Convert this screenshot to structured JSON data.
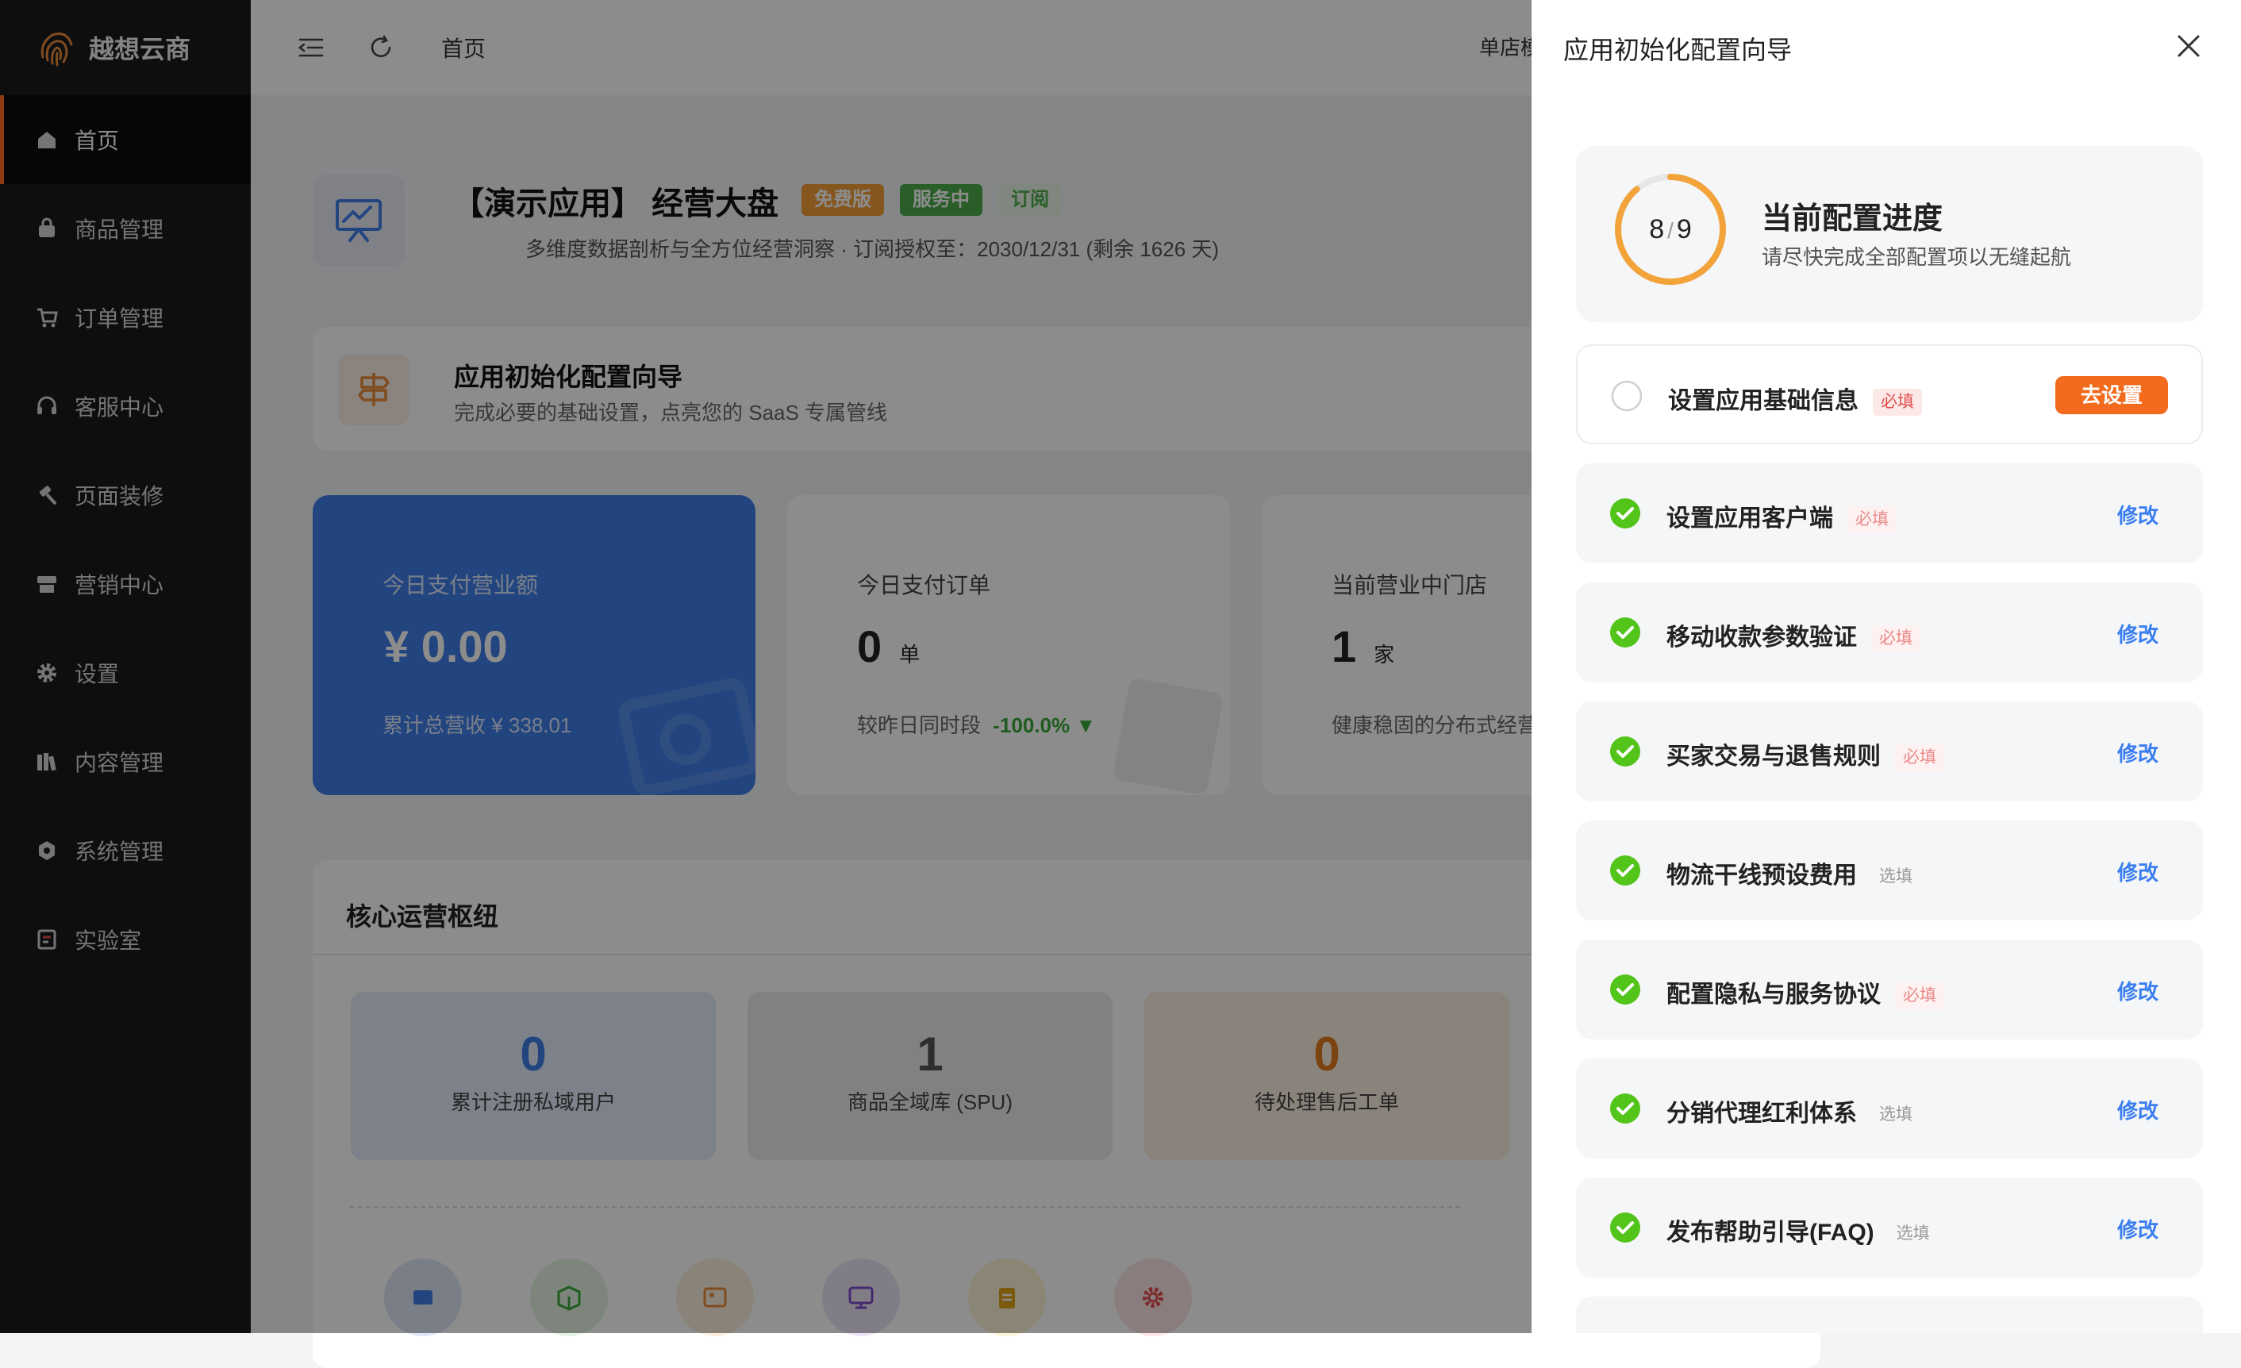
{
  "sidebar": {
    "brand": "越想云商",
    "items": [
      {
        "label": "首页",
        "icon": "home-icon",
        "active": true
      },
      {
        "label": "商品管理",
        "icon": "bag-icon"
      },
      {
        "label": "订单管理",
        "icon": "cart-icon"
      },
      {
        "label": "客服中心",
        "icon": "headset-icon"
      },
      {
        "label": "页面装修",
        "icon": "hammer-icon"
      },
      {
        "label": "营销中心",
        "icon": "store-icon"
      },
      {
        "label": "设置",
        "icon": "gear-icon"
      },
      {
        "label": "内容管理",
        "icon": "books-icon"
      },
      {
        "label": "系统管理",
        "icon": "settings-badge-icon"
      },
      {
        "label": "实验室",
        "icon": "lab-icon"
      }
    ]
  },
  "topbar": {
    "breadcrumb": "首页",
    "store_switch": "单店模"
  },
  "app": {
    "title": "【演示应用】 经营大盘",
    "tags": [
      "免费版",
      "服务中",
      "订阅"
    ],
    "subtitle": "多维度数据剖析与全方位经营洞察 · 订阅授权至：2030/12/31 (剩余 1626 天)"
  },
  "wizard_card": {
    "title": "应用初始化配置向导",
    "subtitle": "完成必要的基础设置，点亮您的 SaaS 专属管线"
  },
  "stats": [
    {
      "label": "今日支付营业额",
      "value": "¥ 0.00",
      "unit": "",
      "foot": "累计总营收  ¥ 338.01"
    },
    {
      "label": "今日支付订单",
      "value": "0",
      "unit": "单",
      "foot": "较昨日同时段",
      "delta": "-100.0%"
    },
    {
      "label": "当前营业中门店",
      "value": "1",
      "unit": "家",
      "foot": "健康稳固的分布式经营"
    }
  ],
  "hub": {
    "title": "核心运营枢纽",
    "tiles": [
      {
        "value": "0",
        "label": "累计注册私域用户",
        "color": "#3f7ee8",
        "bg": "#e4ecf9"
      },
      {
        "value": "1",
        "label": "商品全域库 (SPU)",
        "color": "#555555",
        "bg": "#ececec"
      },
      {
        "value": "0",
        "label": "待处理售后工单",
        "color": "#e07b1f",
        "bg": "#fbeee0"
      }
    ],
    "quick_icons": [
      "shop-icon",
      "box-icon",
      "image-icon",
      "monitor-icon",
      "clipboard-icon",
      "cog-icon"
    ]
  },
  "drawer": {
    "title": "应用初始化配置向导",
    "progress": {
      "done": 8,
      "total": 9,
      "title": "当前配置进度",
      "subtitle": "请尽快完成全部配置项以无缝起航"
    },
    "steps": [
      {
        "name": "设置应用基础信息",
        "badge": "必填",
        "badge_type": "req",
        "status": "todo",
        "action": "去设置"
      },
      {
        "name": "设置应用客户端",
        "badge": "必填",
        "badge_type": "req faded",
        "status": "done",
        "action": "修改"
      },
      {
        "name": "移动收款参数验证",
        "badge": "必填",
        "badge_type": "req faded",
        "status": "done",
        "action": "修改"
      },
      {
        "name": "买家交易与退售规则",
        "badge": "必填",
        "badge_type": "req faded",
        "status": "done",
        "action": "修改"
      },
      {
        "name": "物流干线预设费用",
        "badge": "选填",
        "badge_type": "opt",
        "status": "done",
        "action": "修改"
      },
      {
        "name": "配置隐私与服务协议",
        "badge": "必填",
        "badge_type": "req faded",
        "status": "done",
        "action": "修改"
      },
      {
        "name": "分销代理红利体系",
        "badge": "选填",
        "badge_type": "opt",
        "status": "done",
        "action": "修改"
      },
      {
        "name": "发布帮助引导(FAQ)",
        "badge": "选填",
        "badge_type": "opt",
        "status": "done",
        "action": "修改"
      }
    ]
  },
  "colors": {
    "accent": "#f26b1d",
    "primary": "#3a7ef0",
    "success": "#52c41a",
    "ring": "#f2a33a"
  }
}
